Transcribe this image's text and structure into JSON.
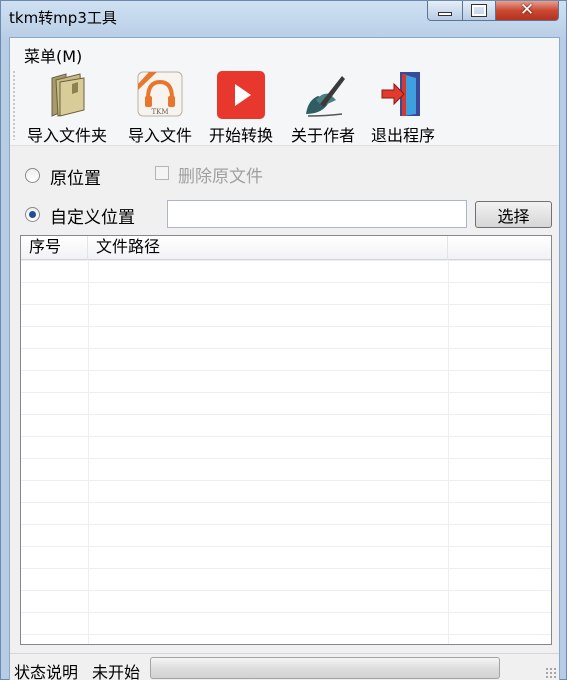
{
  "window": {
    "title": "tkm转mp3工具"
  },
  "menu": {
    "items": [
      "菜单(M)"
    ]
  },
  "toolbar": {
    "buttons": [
      {
        "label": "导入文件夹",
        "icon": "folder-icon"
      },
      {
        "label": "导入文件",
        "icon": "tkm-headphones-icon"
      },
      {
        "label": "开始转换",
        "icon": "play-icon"
      },
      {
        "label": "关于作者",
        "icon": "pen-hand-icon"
      },
      {
        "label": "退出程序",
        "icon": "exit-door-icon"
      }
    ]
  },
  "options": {
    "original_location_label": "原位置",
    "delete_original_label": "删除原文件",
    "custom_location_label": "自定义位置",
    "selected": "custom",
    "path_value": "",
    "choose_button_label": "选择"
  },
  "list": {
    "columns": [
      "序号",
      "文件路径",
      ""
    ],
    "rows": []
  },
  "status": {
    "label": "状态说明",
    "value": "未开始",
    "progress": 0
  },
  "colors": {
    "play_red": "#e8382e",
    "progress_green": "#37c432"
  }
}
